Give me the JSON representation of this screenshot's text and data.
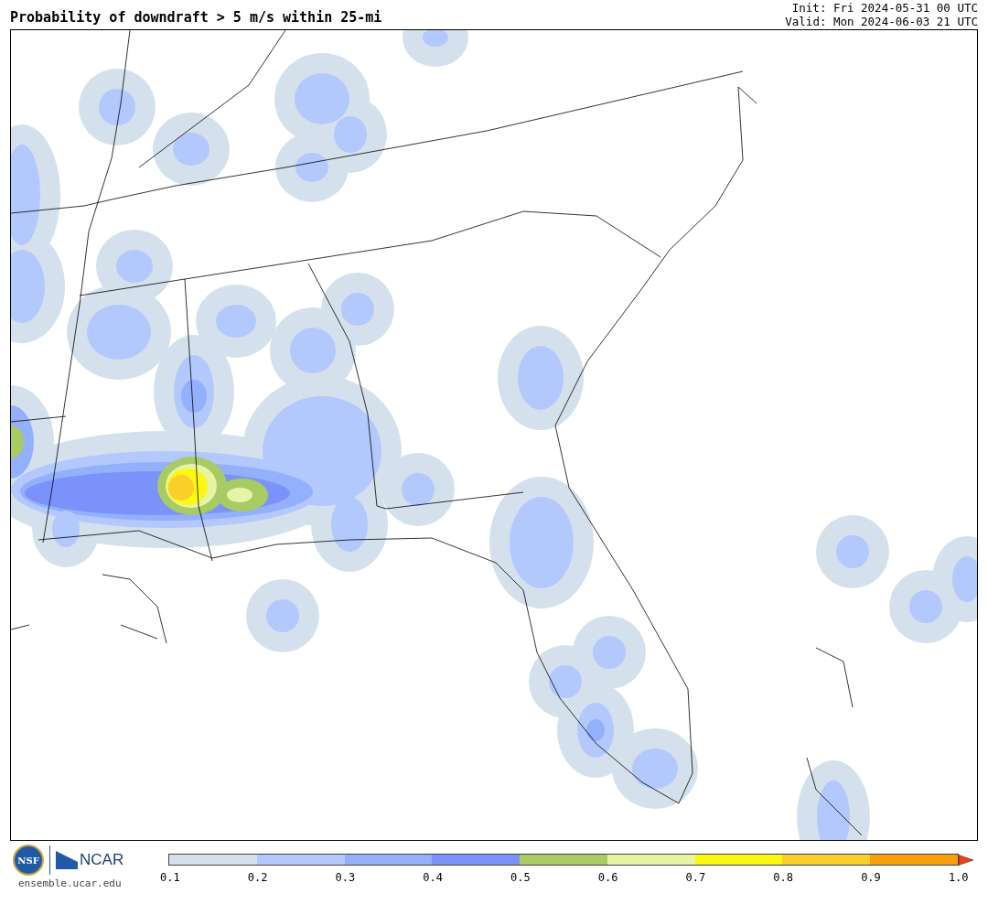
{
  "title": "Probability of downdraft > 5 m/s within 25-mi",
  "init": "Init: Fri 2024-05-31 00 UTC",
  "valid": "Valid: Mon 2024-06-03 21 UTC",
  "logos": {
    "nsf": "NSF",
    "ncar": "NCAR",
    "url": "ensemble.ucar.edu"
  },
  "colorbar": {
    "bins": [
      {
        "color": "#d4e1ec"
      },
      {
        "color": "#b3c8fd"
      },
      {
        "color": "#93b0fc"
      },
      {
        "color": "#7b92fb"
      },
      {
        "color": "#a8cb64"
      },
      {
        "color": "#e6f5a3"
      },
      {
        "color": "#fdf811"
      },
      {
        "color": "#fbcf29"
      },
      {
        "color": "#f89f0a"
      },
      {
        "color": "#ee4010",
        "kind": "arrow"
      }
    ],
    "ticks": [
      "0.1",
      "0.2",
      "0.3",
      "0.4",
      "0.5",
      "0.6",
      "0.7",
      "0.8",
      "0.9",
      "1.0"
    ]
  }
}
